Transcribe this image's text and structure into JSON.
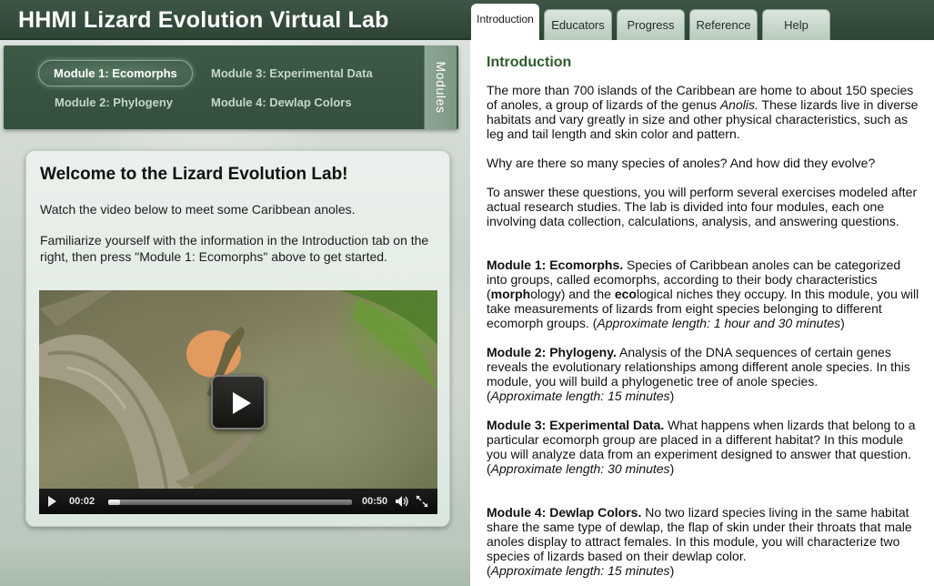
{
  "app": {
    "title": "HHMI Lizard Evolution Virtual Lab"
  },
  "tabs": [
    {
      "label": "Introduction",
      "active": true
    },
    {
      "label": "Educators",
      "active": false
    },
    {
      "label": "Progress",
      "active": false
    },
    {
      "label": "Reference",
      "active": false
    },
    {
      "label": "Help",
      "active": false
    }
  ],
  "modules": {
    "items": [
      {
        "label": "Module 1: Ecomorphs",
        "active": true
      },
      {
        "label": "Module 2: Phylogeny",
        "active": false
      },
      {
        "label": "Module 3: Experimental Data",
        "active": false
      },
      {
        "label": "Module 4: Dewlap Colors",
        "active": false
      }
    ],
    "side_tab_label": "Modules"
  },
  "welcome": {
    "title": "Welcome to the Lizard Evolution Lab!",
    "intro": "Watch the video below to meet some Caribbean anoles.",
    "instructions": "Familiarize yourself with the information in the Introduction tab on the right, then press \"Module 1: Ecomorphs\" above to get started."
  },
  "video": {
    "current_time": "00:02",
    "duration": "00:50",
    "progress": 0.05
  },
  "introduction": {
    "heading": "Introduction",
    "p1_a": "The more than 700 islands of the Caribbean are home to about 150 species of anoles, a group of lizards of the genus ",
    "p1_genus": "Anolis.",
    "p1_b": " These lizards live in diverse habitats and vary greatly in size and other physical characteristics, such as leg and tail length and skin color and pattern.",
    "p2": "Why are there so many species of anoles? And how did they evolve?",
    "p3": "To answer these questions, you will perform several exercises modeled after actual research studies. The lab is divided into four modules, each one involving data collection, calculations, analysis, and answering questions.",
    "m1": {
      "title": "Module 1: Ecomorphs.",
      "text_a": " Species of Caribbean anoles can be categorized into groups, called ecomorphs, according to their body characteristics (",
      "morph_bold": "morph",
      "morph_rest": "ology) and the ",
      "eco_bold": "eco",
      "eco_rest": "logical niches they occupy. In this module, you will take measurements of lizards from eight species belonging to different ecomorph groups. (",
      "length": "Approximate length: 1 hour and 30 minutes",
      "close": ")"
    },
    "m2": {
      "title": "Module 2: Phylogeny.",
      "text": " Analysis of the DNA sequences of certain genes reveals the evolutionary relationships among different anole species. In this module, you will build a phylogenetic tree of anole species.",
      "open": "(",
      "length": "Approximate length: 15 minutes",
      "close": ")"
    },
    "m3": {
      "title": "Module 3: Experimental Data.",
      "text": " What happens when lizards that belong to a particular ecomorph group are placed in a different habitat? In this module you will analyze data from an experiment designed to answer that question.",
      "open": "(",
      "length": "Approximate length: 30 minutes",
      "close": ")"
    },
    "m4": {
      "title": "Module 4: Dewlap Colors.",
      "text": " No two lizard species living in the same habitat share the same type of dewlap, the flap of skin under their throats that male anoles display to attract females. In this module, you will characterize two species of lizards based on their dewlap color.",
      "open": "(",
      "length": "Approximate length: 15 minutes",
      "close": ")"
    }
  },
  "colors": {
    "header_green": "#2e4435",
    "heading_green": "#2f5a2c",
    "nav_green": "#3d5a46"
  }
}
